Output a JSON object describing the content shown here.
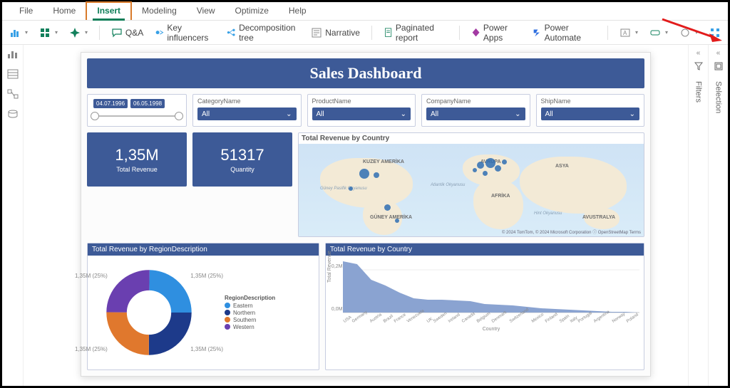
{
  "menu": {
    "items": [
      "File",
      "Home",
      "Insert",
      "Modeling",
      "View",
      "Optimize",
      "Help"
    ],
    "active_index": 2
  },
  "ribbon": {
    "qa": "Q&A",
    "key_influencers": "Key influencers",
    "decomposition_tree": "Decomposition tree",
    "narrative": "Narrative",
    "paginated_report": "Paginated report",
    "power_apps": "Power Apps",
    "power_automate": "Power Automate"
  },
  "right_panes": {
    "filters": "Filters",
    "selection": "Selection"
  },
  "dashboard": {
    "title": "Sales Dashboard",
    "date_slicer": {
      "from": "04.07.1996",
      "to": "06.05.1998"
    },
    "slicers": [
      {
        "label": "CategoryName",
        "value": "All"
      },
      {
        "label": "ProductName",
        "value": "All"
      },
      {
        "label": "CompanyName",
        "value": "All"
      },
      {
        "label": "ShipName",
        "value": "All"
      }
    ],
    "kpis": [
      {
        "value": "1,35M",
        "label": "Total Revenue"
      },
      {
        "value": "51317",
        "label": "Quantity"
      }
    ],
    "donut": {
      "title": "Total Revenue by RegionDescription",
      "legend_title": "RegionDescription",
      "segments": [
        {
          "name": "Eastern",
          "pct": 25,
          "color": "#2f8fe0",
          "label": "1,35M (25%)"
        },
        {
          "name": "Northern",
          "pct": 25,
          "color": "#1d3a8a",
          "label": "1,35M (25%)"
        },
        {
          "name": "Southern",
          "pct": 25,
          "color": "#e0782d",
          "label": "1,35M (25%)"
        },
        {
          "name": "Western",
          "pct": 25,
          "color": "#6a3fb0",
          "label": "1,35M (25%)"
        }
      ]
    },
    "map": {
      "title_outside": "Total Revenue by Country",
      "labels": {
        "na": "KUZEY AMERİKA",
        "sa": "GÜNEY AMERİKA",
        "eu": "AVRUPA",
        "af": "AFRİKA",
        "as": "ASYA",
        "au": "AVUSTRALYA",
        "atl": "Atlantik Okyanusu",
        "pac": "Güney Pasifik Okyanusu",
        "ind": "Hint Okyanusu"
      },
      "attr": "© 2024 TomTom, © 2024 Microsoft Corporation   ⓘ OpenStreetMap  Terms"
    },
    "area": {
      "title": "Total Revenue by Country",
      "ylabel": "Total Revenue",
      "xlabel": "Country",
      "yticks": [
        "0,2M",
        "0,0M"
      ]
    }
  },
  "chart_data": [
    {
      "type": "pie",
      "title": "Total Revenue by RegionDescription",
      "series": [
        {
          "name": "Eastern",
          "value": 25,
          "display": "1,35M (25%)"
        },
        {
          "name": "Northern",
          "value": 25,
          "display": "1,35M (25%)"
        },
        {
          "name": "Southern",
          "value": 25,
          "display": "1,35M (25%)"
        },
        {
          "name": "Western",
          "value": 25,
          "display": "1,35M (25%)"
        }
      ]
    },
    {
      "type": "area",
      "title": "Total Revenue by Country",
      "xlabel": "Country",
      "ylabel": "Total Revenue",
      "ylim": [
        0,
        0.25
      ],
      "y_unit": "M",
      "categories": [
        "USA",
        "Germany",
        "Austria",
        "Brazil",
        "France",
        "Venezuela",
        "UK",
        "Sweden",
        "Ireland",
        "Canada",
        "Belgium",
        "Denmark",
        "Switzerland",
        "Mexico",
        "Finland",
        "Spain",
        "Italy",
        "Portugal",
        "Argentina",
        "Norway",
        "Poland"
      ],
      "values": [
        0.25,
        0.23,
        0.14,
        0.11,
        0.085,
        0.06,
        0.058,
        0.055,
        0.05,
        0.05,
        0.035,
        0.033,
        0.032,
        0.025,
        0.02,
        0.018,
        0.016,
        0.013,
        0.009,
        0.006,
        0.004
      ]
    }
  ]
}
